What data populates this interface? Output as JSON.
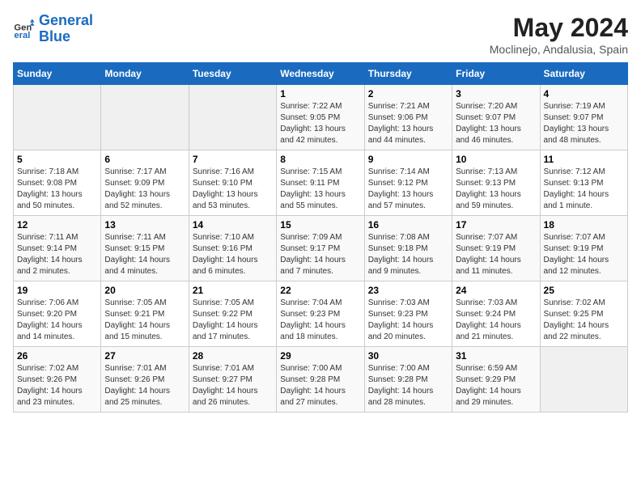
{
  "logo": {
    "line1": "General",
    "line2": "Blue"
  },
  "title": "May 2024",
  "location": "Moclinejo, Andalusia, Spain",
  "weekdays": [
    "Sunday",
    "Monday",
    "Tuesday",
    "Wednesday",
    "Thursday",
    "Friday",
    "Saturday"
  ],
  "weeks": [
    [
      {
        "day": null
      },
      {
        "day": null
      },
      {
        "day": null
      },
      {
        "day": "1",
        "sunrise": "Sunrise: 7:22 AM",
        "sunset": "Sunset: 9:05 PM",
        "daylight": "Daylight: 13 hours and 42 minutes."
      },
      {
        "day": "2",
        "sunrise": "Sunrise: 7:21 AM",
        "sunset": "Sunset: 9:06 PM",
        "daylight": "Daylight: 13 hours and 44 minutes."
      },
      {
        "day": "3",
        "sunrise": "Sunrise: 7:20 AM",
        "sunset": "Sunset: 9:07 PM",
        "daylight": "Daylight: 13 hours and 46 minutes."
      },
      {
        "day": "4",
        "sunrise": "Sunrise: 7:19 AM",
        "sunset": "Sunset: 9:07 PM",
        "daylight": "Daylight: 13 hours and 48 minutes."
      }
    ],
    [
      {
        "day": "5",
        "sunrise": "Sunrise: 7:18 AM",
        "sunset": "Sunset: 9:08 PM",
        "daylight": "Daylight: 13 hours and 50 minutes."
      },
      {
        "day": "6",
        "sunrise": "Sunrise: 7:17 AM",
        "sunset": "Sunset: 9:09 PM",
        "daylight": "Daylight: 13 hours and 52 minutes."
      },
      {
        "day": "7",
        "sunrise": "Sunrise: 7:16 AM",
        "sunset": "Sunset: 9:10 PM",
        "daylight": "Daylight: 13 hours and 53 minutes."
      },
      {
        "day": "8",
        "sunrise": "Sunrise: 7:15 AM",
        "sunset": "Sunset: 9:11 PM",
        "daylight": "Daylight: 13 hours and 55 minutes."
      },
      {
        "day": "9",
        "sunrise": "Sunrise: 7:14 AM",
        "sunset": "Sunset: 9:12 PM",
        "daylight": "Daylight: 13 hours and 57 minutes."
      },
      {
        "day": "10",
        "sunrise": "Sunrise: 7:13 AM",
        "sunset": "Sunset: 9:13 PM",
        "daylight": "Daylight: 13 hours and 59 minutes."
      },
      {
        "day": "11",
        "sunrise": "Sunrise: 7:12 AM",
        "sunset": "Sunset: 9:13 PM",
        "daylight": "Daylight: 14 hours and 1 minute."
      }
    ],
    [
      {
        "day": "12",
        "sunrise": "Sunrise: 7:11 AM",
        "sunset": "Sunset: 9:14 PM",
        "daylight": "Daylight: 14 hours and 2 minutes."
      },
      {
        "day": "13",
        "sunrise": "Sunrise: 7:11 AM",
        "sunset": "Sunset: 9:15 PM",
        "daylight": "Daylight: 14 hours and 4 minutes."
      },
      {
        "day": "14",
        "sunrise": "Sunrise: 7:10 AM",
        "sunset": "Sunset: 9:16 PM",
        "daylight": "Daylight: 14 hours and 6 minutes."
      },
      {
        "day": "15",
        "sunrise": "Sunrise: 7:09 AM",
        "sunset": "Sunset: 9:17 PM",
        "daylight": "Daylight: 14 hours and 7 minutes."
      },
      {
        "day": "16",
        "sunrise": "Sunrise: 7:08 AM",
        "sunset": "Sunset: 9:18 PM",
        "daylight": "Daylight: 14 hours and 9 minutes."
      },
      {
        "day": "17",
        "sunrise": "Sunrise: 7:07 AM",
        "sunset": "Sunset: 9:19 PM",
        "daylight": "Daylight: 14 hours and 11 minutes."
      },
      {
        "day": "18",
        "sunrise": "Sunrise: 7:07 AM",
        "sunset": "Sunset: 9:19 PM",
        "daylight": "Daylight: 14 hours and 12 minutes."
      }
    ],
    [
      {
        "day": "19",
        "sunrise": "Sunrise: 7:06 AM",
        "sunset": "Sunset: 9:20 PM",
        "daylight": "Daylight: 14 hours and 14 minutes."
      },
      {
        "day": "20",
        "sunrise": "Sunrise: 7:05 AM",
        "sunset": "Sunset: 9:21 PM",
        "daylight": "Daylight: 14 hours and 15 minutes."
      },
      {
        "day": "21",
        "sunrise": "Sunrise: 7:05 AM",
        "sunset": "Sunset: 9:22 PM",
        "daylight": "Daylight: 14 hours and 17 minutes."
      },
      {
        "day": "22",
        "sunrise": "Sunrise: 7:04 AM",
        "sunset": "Sunset: 9:23 PM",
        "daylight": "Daylight: 14 hours and 18 minutes."
      },
      {
        "day": "23",
        "sunrise": "Sunrise: 7:03 AM",
        "sunset": "Sunset: 9:23 PM",
        "daylight": "Daylight: 14 hours and 20 minutes."
      },
      {
        "day": "24",
        "sunrise": "Sunrise: 7:03 AM",
        "sunset": "Sunset: 9:24 PM",
        "daylight": "Daylight: 14 hours and 21 minutes."
      },
      {
        "day": "25",
        "sunrise": "Sunrise: 7:02 AM",
        "sunset": "Sunset: 9:25 PM",
        "daylight": "Daylight: 14 hours and 22 minutes."
      }
    ],
    [
      {
        "day": "26",
        "sunrise": "Sunrise: 7:02 AM",
        "sunset": "Sunset: 9:26 PM",
        "daylight": "Daylight: 14 hours and 23 minutes."
      },
      {
        "day": "27",
        "sunrise": "Sunrise: 7:01 AM",
        "sunset": "Sunset: 9:26 PM",
        "daylight": "Daylight: 14 hours and 25 minutes."
      },
      {
        "day": "28",
        "sunrise": "Sunrise: 7:01 AM",
        "sunset": "Sunset: 9:27 PM",
        "daylight": "Daylight: 14 hours and 26 minutes."
      },
      {
        "day": "29",
        "sunrise": "Sunrise: 7:00 AM",
        "sunset": "Sunset: 9:28 PM",
        "daylight": "Daylight: 14 hours and 27 minutes."
      },
      {
        "day": "30",
        "sunrise": "Sunrise: 7:00 AM",
        "sunset": "Sunset: 9:28 PM",
        "daylight": "Daylight: 14 hours and 28 minutes."
      },
      {
        "day": "31",
        "sunrise": "Sunrise: 6:59 AM",
        "sunset": "Sunset: 9:29 PM",
        "daylight": "Daylight: 14 hours and 29 minutes."
      },
      {
        "day": null
      }
    ]
  ]
}
